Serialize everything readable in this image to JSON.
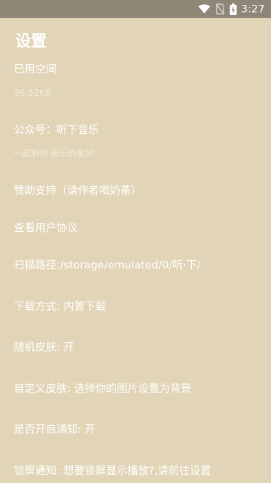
{
  "status_bar": {
    "time": "3:27",
    "icons": [
      "wifi-icon",
      "no-sim-icon",
      "battery-charging-icon"
    ]
  },
  "page": {
    "title": "设置"
  },
  "settings": {
    "storage": {
      "label": "已用空间",
      "value": "36.52KB"
    },
    "official_account": {
      "label": "公众号：听下音乐",
      "subtitle": "一起聆听音乐的美好"
    },
    "support": {
      "label": "赞助支持（请作者喝奶茶）"
    },
    "agreement": {
      "label": "查看用户协议"
    },
    "scan_path": {
      "label": "扫描路径:/storage/emulated/0/听·下/"
    },
    "download_mode": {
      "label": "下载方式: 内置下载"
    },
    "random_skin": {
      "label": "随机皮肤: 开"
    },
    "custom_skin": {
      "label": "自定义皮肤:  选择你的图片设置为背景"
    },
    "notification": {
      "label": "是否开启通知: 开"
    },
    "lockscreen_notification": {
      "label": "锁屏通知:  想要锁屏显示播放?,请前往设置"
    }
  }
}
